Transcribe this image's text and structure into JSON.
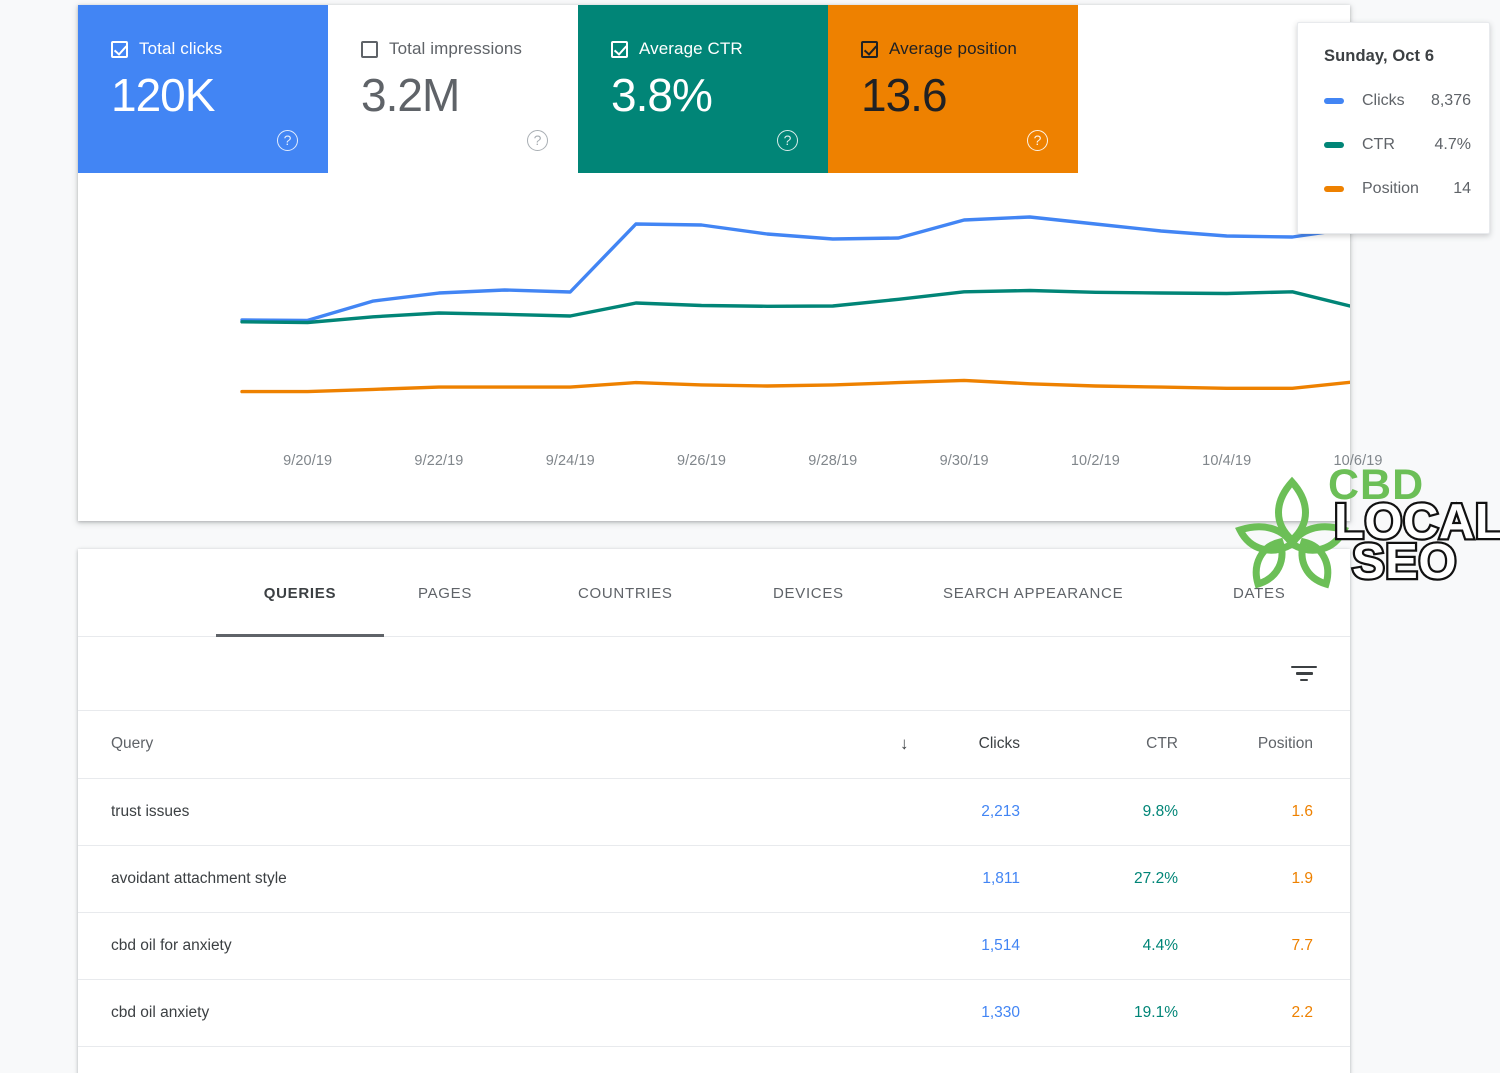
{
  "metric_cards": [
    {
      "label": "Total clicks",
      "value": "120K",
      "checked": true,
      "color": "#4285f4",
      "icon": "help-icon"
    },
    {
      "label": "Total impressions",
      "value": "3.2M",
      "checked": false,
      "color": "#ffffff",
      "icon": "help-icon"
    },
    {
      "label": "Average CTR",
      "value": "3.8%",
      "checked": true,
      "color": "#018577",
      "icon": "help-icon"
    },
    {
      "label": "Average position",
      "value": "13.6",
      "checked": true,
      "color": "#ee8100",
      "icon": "help-icon"
    }
  ],
  "tooltip": {
    "title": "Sunday, Oct 6",
    "rows": [
      {
        "name": "Clicks",
        "value": "8,376",
        "color": "#4285f4"
      },
      {
        "name": "CTR",
        "value": "4.7%",
        "color": "#018577"
      },
      {
        "name": "Position",
        "value": "14",
        "color": "#ee8100"
      }
    ]
  },
  "chart_data": {
    "type": "line",
    "title": "",
    "xlabel": "",
    "ylabel": "",
    "grid": false,
    "legend": "tooltip",
    "x": [
      "9/19/19",
      "9/20/19",
      "9/21/19",
      "9/22/19",
      "9/23/19",
      "9/24/19",
      "9/25/19",
      "9/26/19",
      "9/27/19",
      "9/28/19",
      "9/29/19",
      "9/30/19",
      "10/1/19",
      "10/2/19",
      "10/3/19",
      "10/4/19",
      "10/5/19",
      "10/6/19"
    ],
    "tick_labels": [
      "9/20/19",
      "9/22/19",
      "9/24/19",
      "9/26/19",
      "9/28/19",
      "9/30/19",
      "10/2/19",
      "10/4/19",
      "10/6/19"
    ],
    "highlight_date": "10/6/19",
    "series": [
      {
        "name": "Clicks",
        "color": "#4285f4",
        "values": [
          3750,
          3730,
          4700,
          5100,
          5250,
          5150,
          8550,
          8500,
          8050,
          7800,
          7850,
          8750,
          8900,
          8550,
          8200,
          7950,
          7900,
          8376
        ]
      },
      {
        "name": "CTR",
        "color": "#018577",
        "values": [
          4150,
          4120,
          4350,
          4500,
          4450,
          4380,
          4900,
          4800,
          4770,
          4780,
          5050,
          5350,
          5400,
          5330,
          5300,
          5280,
          5350,
          4700
        ]
      },
      {
        "name": "Position",
        "color": "#ee8100",
        "values": [
          14.9,
          14.9,
          14.7,
          14.5,
          14.5,
          14.5,
          14.1,
          14.3,
          14.4,
          14.3,
          14.1,
          13.9,
          14.2,
          14.4,
          14.5,
          14.6,
          14.6,
          14.0
        ]
      }
    ]
  },
  "tabs": [
    {
      "label": "QUERIES",
      "active": true
    },
    {
      "label": "PAGES",
      "active": false
    },
    {
      "label": "COUNTRIES",
      "active": false
    },
    {
      "label": "DEVICES",
      "active": false
    },
    {
      "label": "SEARCH APPEARANCE",
      "active": false
    },
    {
      "label": "DATES",
      "active": false
    }
  ],
  "filter": {
    "icon": "filter-icon"
  },
  "table": {
    "columns": {
      "query": "Query",
      "clicks": "Clicks",
      "ctr": "CTR",
      "position": "Position"
    },
    "sort": {
      "column": "Clicks",
      "direction": "↓"
    },
    "rows": [
      {
        "query": "trust issues",
        "clicks": "2,213",
        "ctr": "9.8%",
        "position": "1.6"
      },
      {
        "query": "avoidant attachment style",
        "clicks": "1,811",
        "ctr": "27.2%",
        "position": "1.9"
      },
      {
        "query": "cbd oil for anxiety",
        "clicks": "1,514",
        "ctr": "4.4%",
        "position": "7.7"
      },
      {
        "query": "cbd oil anxiety",
        "clicks": "1,330",
        "ctr": "19.1%",
        "position": "2.2"
      }
    ]
  },
  "logo": {
    "line1": "CBD",
    "line2": "LOCAL",
    "line3": "SEO",
    "green": "#6cbf57"
  }
}
